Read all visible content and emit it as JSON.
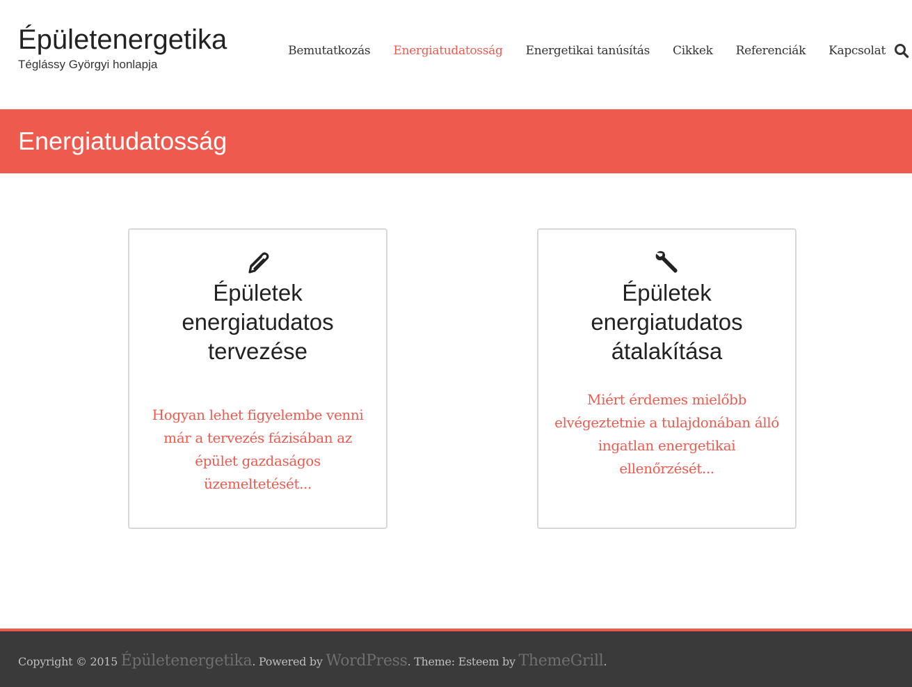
{
  "header": {
    "site_title": "Épületenergetika",
    "site_description": "Téglássy Györgyi honlapja"
  },
  "nav": {
    "items": [
      {
        "label": "Bemutatkozás"
      },
      {
        "label": "Energiatudatosság",
        "active": true
      },
      {
        "label": "Energetikai tanúsítás"
      },
      {
        "label": "Cikkek"
      },
      {
        "label": "Referenciák"
      },
      {
        "label": "Kapcsolat"
      }
    ],
    "search_icon": "search-icon"
  },
  "page": {
    "title": "Energiatudatosság"
  },
  "cards": [
    {
      "icon": "pencil-icon",
      "title": "Épületek energiatudatos tervezése",
      "text": "Hogyan lehet figyelembe venni már a tervezés fázisában az épület gazdaságos üzemeltetését..."
    },
    {
      "icon": "wrench-icon",
      "title": "Épületek energiatudatos átalakítása",
      "text": "Miért érdemes mielőbb elvégeztetnie a tulajdonában álló ingatlan energetikai ellenőrzését..."
    }
  ],
  "footer": {
    "copyright_prefix": "Copyright © 2015",
    "site_link": "Épületenergetika",
    "powered_by": ". Powered by",
    "wordpress_link": "WordPress",
    "theme_text": ". Theme: Esteem by",
    "themegrill_link": "ThemeGrill",
    "suffix": "."
  },
  "colors": {
    "accent": "#ee5a4e",
    "footer_bg": "#3a3a3a",
    "text": "#333333"
  }
}
